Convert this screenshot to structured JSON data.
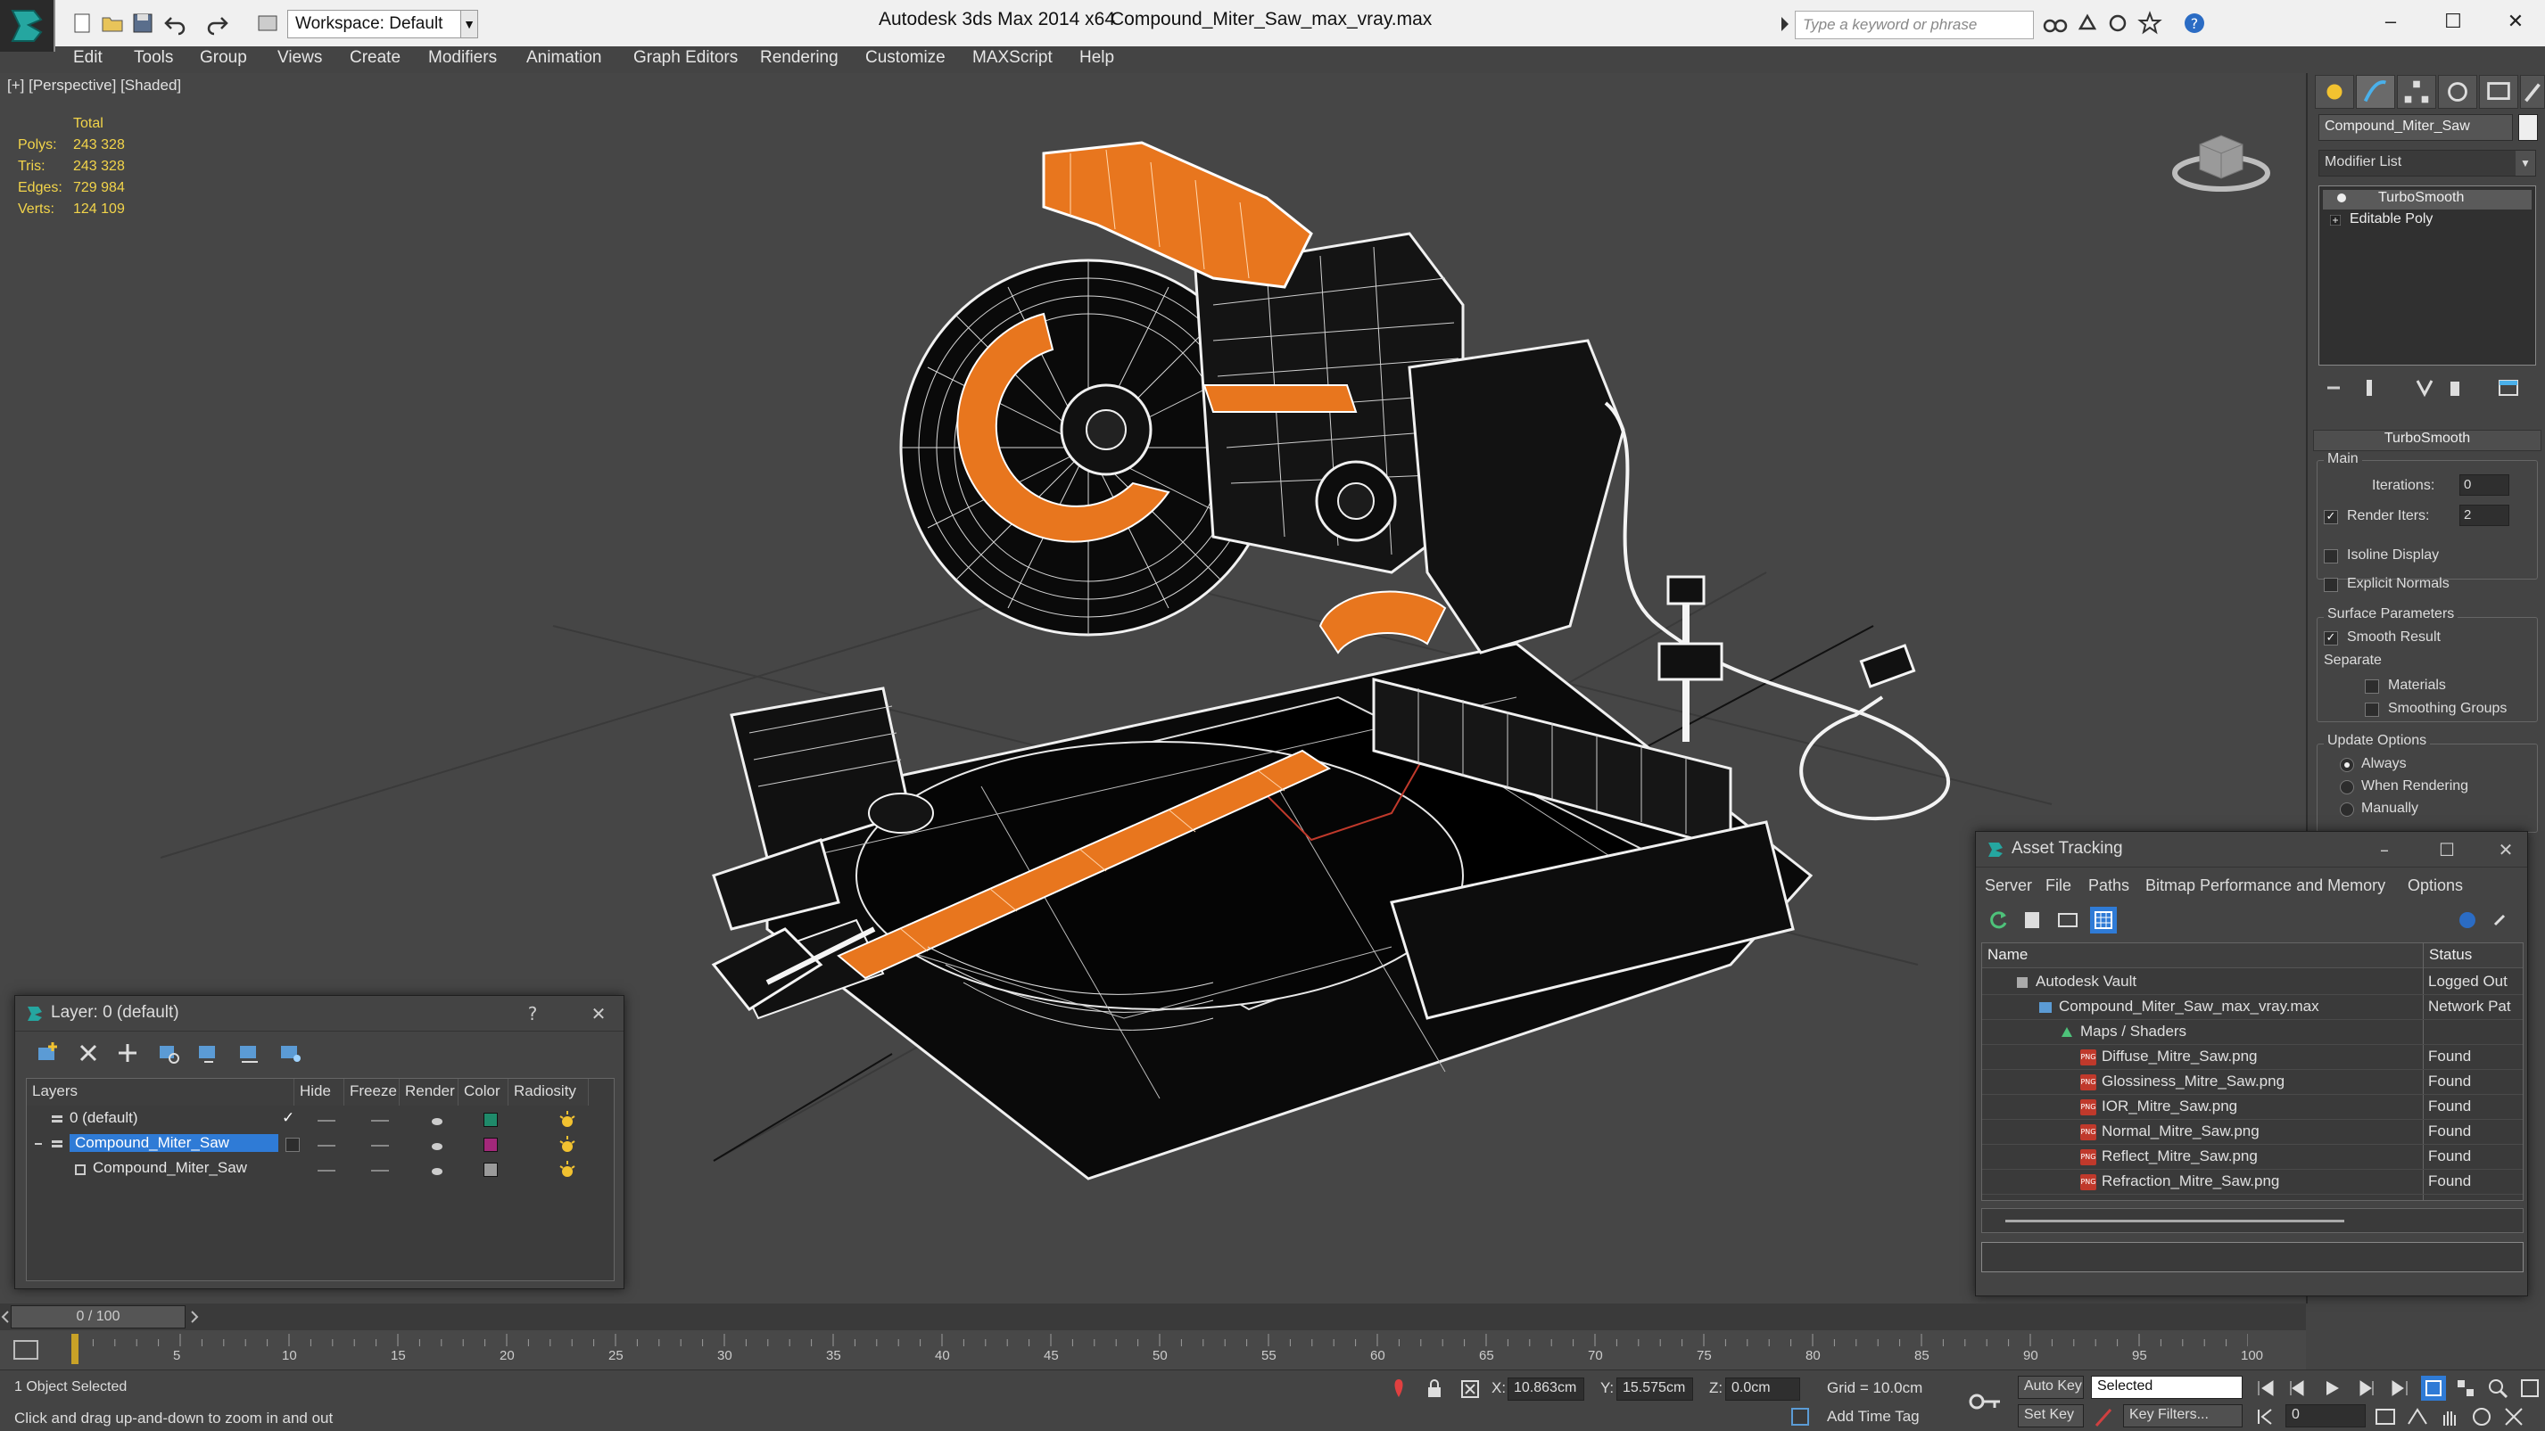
{
  "titlebar": {
    "workspace_label": "Workspace: Default",
    "app_title": "Autodesk 3ds Max  2014 x64",
    "file_title": "Compound_Miter_Saw_max_vray.max",
    "search_placeholder": "Type a keyword or phrase",
    "minimize": "–",
    "maximize": "☐",
    "close": "✕"
  },
  "menu": [
    "Edit",
    "Tools",
    "Group",
    "Views",
    "Create",
    "Modifiers",
    "Animation",
    "Graph Editors",
    "Rendering",
    "Customize",
    "MAXScript",
    "Help"
  ],
  "viewport": {
    "label": "[+] [Perspective] [Shaded]",
    "stats": {
      "header": "Total",
      "rows": [
        {
          "label": "Polys:",
          "value": "243 328"
        },
        {
          "label": "Tris:",
          "value": "243 328"
        },
        {
          "label": "Edges:",
          "value": "729 984"
        },
        {
          "label": "Verts:",
          "value": "124 109"
        }
      ]
    }
  },
  "command_panel": {
    "object_name": "Compound_Miter_Saw",
    "modifier_list": "Modifier List",
    "stack": [
      "TurboSmooth",
      "Editable Poly"
    ],
    "rollout": {
      "title": "TurboSmooth",
      "main_label": "Main",
      "iterations_label": "Iterations:",
      "iterations_value": "0",
      "render_iters_label": "Render Iters:",
      "render_iters_value": "2",
      "render_iters_checked": "✓",
      "isoline_label": "Isoline Display",
      "explicit_normals_label": "Explicit Normals",
      "surface_params_label": "Surface Parameters",
      "smooth_result_label": "Smooth Result",
      "smooth_result_checked": "✓",
      "separate_label": "Separate",
      "materials_label": "Materials",
      "smoothing_groups_label": "Smoothing Groups",
      "update_options_label": "Update Options",
      "always_label": "Always",
      "when_rendering_label": "When Rendering",
      "manually_label": "Manually"
    }
  },
  "layer_dialog": {
    "title": "Layer: 0 (default)",
    "help": "?",
    "close": "✕",
    "columns": [
      "Layers",
      "Hide",
      "Freeze",
      "Render",
      "Color",
      "Radiosity"
    ],
    "rows": [
      {
        "name": "0 (default)",
        "active_mark": "✓",
        "color": "#1f8a6a"
      },
      {
        "name": "Compound_Miter_Saw",
        "active_mark": "",
        "color": "#a3287a"
      },
      {
        "name": "Compound_Miter_Saw",
        "active_mark": "",
        "color": "#9a9a9a"
      }
    ]
  },
  "asset_dialog": {
    "title": "Asset Tracking",
    "menu": [
      "Server",
      "File",
      "Paths",
      "Bitmap Performance and Memory",
      "Options"
    ],
    "columns": [
      "Name",
      "Status"
    ],
    "rows": [
      {
        "name": "Autodesk Vault",
        "status": "Logged Out"
      },
      {
        "name": "Compound_Miter_Saw_max_vray.max",
        "status": "Network Pat"
      },
      {
        "name": "Maps / Shaders",
        "status": ""
      },
      {
        "name": "Diffuse_Mitre_Saw.png",
        "status": "Found"
      },
      {
        "name": "Glossiness_Mitre_Saw.png",
        "status": "Found"
      },
      {
        "name": "IOR_Mitre_Saw.png",
        "status": "Found"
      },
      {
        "name": "Normal_Mitre_Saw.png",
        "status": "Found"
      },
      {
        "name": "Reflect_Mitre_Saw.png",
        "status": "Found"
      },
      {
        "name": "Refraction_Mitre_Saw.png",
        "status": "Found"
      }
    ],
    "png_badge": "PNG"
  },
  "timeline": {
    "frame_display": "0 / 100",
    "ticks": [
      "5",
      "10",
      "15",
      "20",
      "25",
      "30",
      "35",
      "40",
      "45",
      "50",
      "55",
      "60",
      "65",
      "70",
      "75",
      "80",
      "85",
      "90",
      "95",
      "100"
    ]
  },
  "statusbar": {
    "selection": "1 Object Selected",
    "prompt": "Click and drag up-and-down to zoom in and out",
    "x_label": "X:",
    "x_value": "10.863cm",
    "y_label": "Y:",
    "y_value": "15.575cm",
    "z_label": "Z:",
    "z_value": "0.0cm",
    "grid": "Grid = 10.0cm",
    "add_time_tag": "Add Time Tag",
    "auto_key": "Auto Key",
    "auto_key_select": "Selected",
    "set_key": "Set Key",
    "key_filters": "Key Filters...",
    "frame_value": "0"
  },
  "colors": {
    "accent_orange": "#e8761e",
    "wire_white": "#f4f4f4",
    "stats_yellow": "#f2d44a",
    "selection_blue": "#2f7bd6"
  }
}
